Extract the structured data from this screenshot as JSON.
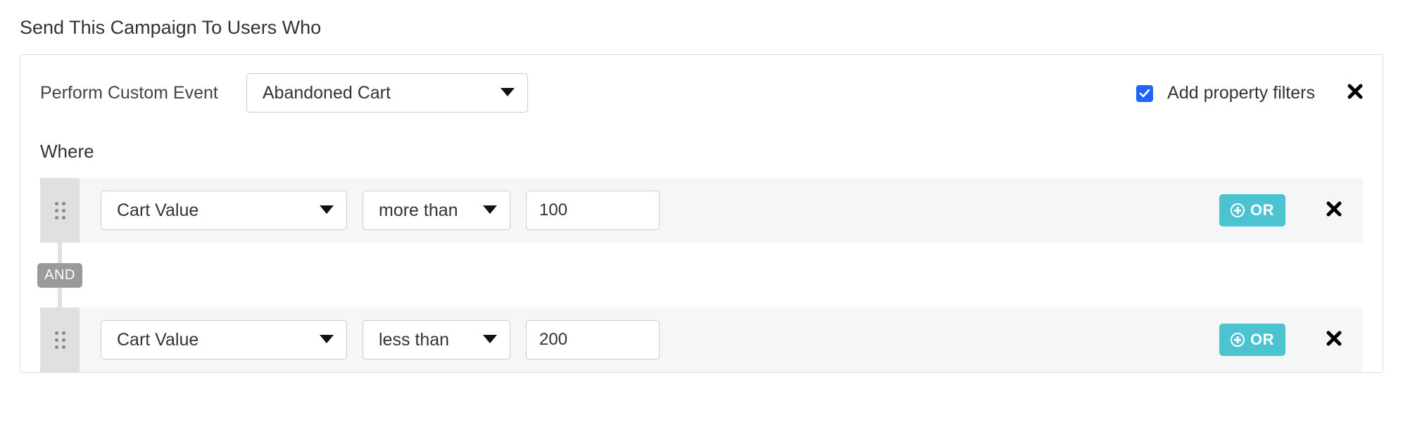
{
  "title": "Send This Campaign To Users Who",
  "perform_label": "Perform Custom Event",
  "event_select": {
    "value": "Abandoned Cart"
  },
  "add_property_filters": {
    "label": "Add property filters",
    "checked": true
  },
  "where_label": "Where",
  "joiner_label": "AND",
  "or_button_label": "OR",
  "filters": [
    {
      "property": "Cart Value",
      "operator": "more than",
      "value": "100"
    },
    {
      "property": "Cart Value",
      "operator": "less than",
      "value": "200"
    }
  ]
}
